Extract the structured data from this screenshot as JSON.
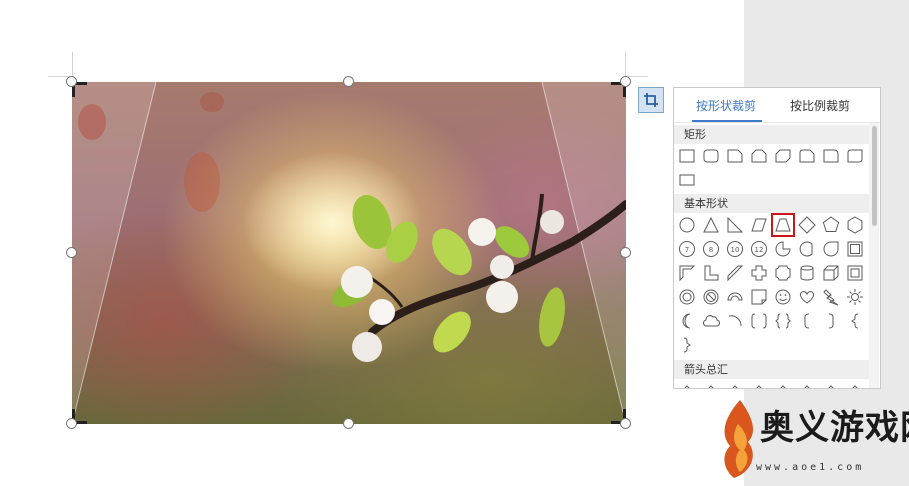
{
  "crop_panel": {
    "tabs": [
      {
        "label": "按形状裁剪",
        "active": true
      },
      {
        "label": "按比例裁剪",
        "active": false
      }
    ],
    "sections": [
      {
        "label": "矩形",
        "shapes": [
          "rect",
          "round-rect",
          "snip-one",
          "snip-same",
          "snip-diag",
          "snip-round",
          "round-one",
          "round-diag",
          "rect-small"
        ]
      },
      {
        "label": "基本形状",
        "shapes": [
          "ellipse",
          "triangle",
          "right-triangle",
          "parallelogram",
          "trapezoid",
          "diamond",
          "pentagon",
          "hexagon",
          "heptagon",
          "octagon",
          "decagon",
          "dodecagon",
          "pie",
          "chord",
          "teardrop",
          "frame",
          "half-frame",
          "l-shape",
          "diagonal-stripe",
          "plus",
          "plaque",
          "can",
          "cube",
          "bevel",
          "donut",
          "no-symbol",
          "block-arc",
          "folded-corner",
          "smiley",
          "heart",
          "lightning",
          "sun",
          "moon",
          "cloud",
          "arc",
          "double-bracket",
          "double-brace",
          "left-bracket",
          "right-bracket",
          "left-brace",
          "right-brace"
        ]
      },
      {
        "label": "箭头总汇",
        "shapes": []
      }
    ],
    "selected_shape": "trapezoid",
    "accent_color": "#3f79c9",
    "selection_color": "#c8171b",
    "badges": {
      "heptagon": "7",
      "octagon": "8",
      "decagon": "10",
      "dodecagon": "12"
    }
  },
  "crop_button": {
    "icon": "crop-icon"
  },
  "watermark": {
    "brand": "奥义游戏网",
    "url": "www.aoe1.com"
  }
}
